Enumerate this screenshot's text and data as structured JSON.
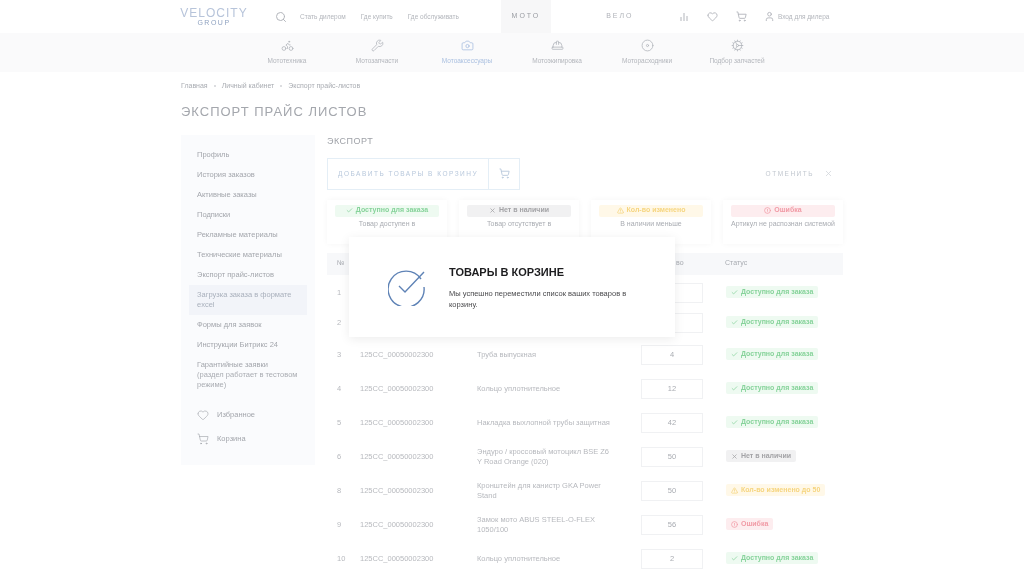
{
  "header": {
    "logo": "VELOCITY",
    "logo_sub": "GROUP",
    "links": [
      "Стать дилером",
      "Где купить",
      "Где обслуживать"
    ],
    "tabs": [
      {
        "label": "МОТО",
        "selected": true
      },
      {
        "label": "ВЕЛО",
        "selected": false
      }
    ],
    "login": "Вход для дилера"
  },
  "categories": [
    {
      "kind": "bike",
      "label": "Мототехника",
      "selected": false
    },
    {
      "kind": "parts",
      "label": "Мотозапчасти",
      "selected": false
    },
    {
      "kind": "accessories",
      "label": "Мотоаксессуары",
      "selected": true
    },
    {
      "kind": "gear",
      "label": "Мотоэкипировка",
      "selected": false
    },
    {
      "kind": "consumables",
      "label": "Моторасходники",
      "selected": false
    },
    {
      "kind": "selection",
      "label": "Подбор запчастей",
      "selected": false
    }
  ],
  "breadcrumbs": [
    "Главная",
    "Личный кабинет",
    "Экспорт прайс-листов"
  ],
  "title": "ЭКСПОРТ ПРАЙС ЛИСТОВ",
  "sidebar": {
    "items": [
      {
        "label": "Профиль",
        "selected": false
      },
      {
        "label": "История заказов",
        "selected": false
      },
      {
        "label": "Активные заказы",
        "selected": false
      },
      {
        "label": "Подписки",
        "selected": false
      },
      {
        "label": "Рекламные материалы",
        "selected": false
      },
      {
        "label": "Технические материалы",
        "selected": false
      },
      {
        "label": "Экспорт прайс-листов",
        "selected": false
      },
      {
        "label": "Загрузка заказа в формате excel",
        "selected": true
      },
      {
        "label": "Формы для заявок",
        "selected": false
      },
      {
        "label": "Инструкции Битрикс 24",
        "selected": false
      },
      {
        "label": "Гарантийные заявки",
        "note": "(раздел работает в тестовом режиме)",
        "selected": false
      }
    ],
    "extras": [
      {
        "kind": "favorites",
        "label": "Избранное"
      },
      {
        "kind": "cart",
        "label": "Корзина"
      }
    ]
  },
  "section_title": "ЭКСПОРТ",
  "add_button": "ДОБАВИТЬ ТОВАРЫ В КОРЗИНУ",
  "cancel_button": "ОТМЕНИТЬ",
  "legend": [
    {
      "kind": "available",
      "label": "Доступно для заказа",
      "description": "Товар доступен в"
    },
    {
      "kind": "out",
      "label": "Нет в наличии",
      "description": "Товар отсутствует в"
    },
    {
      "kind": "changed",
      "label": "Кол-во изменено",
      "description": "В наличии меньше"
    },
    {
      "kind": "error",
      "label": "Ошибка",
      "description": "Артикул не распознан системой"
    }
  ],
  "table": {
    "columns": {
      "number": "№",
      "quantity": "во",
      "status": "Статус"
    },
    "rows": [
      {
        "number": "1",
        "status": {
          "kind": "available",
          "label": "Доступно для заказа"
        }
      },
      {
        "number": "2",
        "status": {
          "kind": "available",
          "label": "Доступно для заказа"
        }
      },
      {
        "number": "3",
        "article": "125CC_00050002300",
        "name": "Труба выпускная",
        "quantity": "4",
        "status": {
          "kind": "available",
          "label": "Доступно для заказа"
        }
      },
      {
        "number": "4",
        "article": "125CC_00050002300",
        "name": "Кольцо уплотнительное",
        "quantity": "12",
        "status": {
          "kind": "available",
          "label": "Доступно для заказа"
        }
      },
      {
        "number": "5",
        "article": "125CC_00050002300",
        "name": "Накладка выхлопной трубы защитная",
        "quantity": "42",
        "status": {
          "kind": "available",
          "label": "Доступно для заказа"
        }
      },
      {
        "number": "6",
        "article": "125CC_00050002300",
        "name": "Эндуро / кроссовый мотоцикл BSE Z6 Y Road Orange (020)",
        "quantity": "50",
        "status": {
          "kind": "out",
          "label": "Нет в наличии"
        }
      },
      {
        "number": "8",
        "article": "125CC_00050002300",
        "name": "Кронштейн для канистр GKA Power Stand",
        "quantity": "50",
        "status": {
          "kind": "changed",
          "label": "Кол-во изменено до 50"
        }
      },
      {
        "number": "9",
        "article": "125CC_00050002300",
        "name": "Замок мото ABUS STEEL-O-FLEX 1050/100",
        "quantity": "56",
        "status": {
          "kind": "error",
          "label": "Ошибка"
        }
      },
      {
        "number": "10",
        "article": "125CC_00050002300",
        "name": "Кольцо уплотнительное",
        "quantity": "2",
        "status": {
          "kind": "available",
          "label": "Доступно для заказа"
        }
      }
    ]
  },
  "modal": {
    "title": "ТОВАРЫ В КОРЗИНЕ",
    "message": "Мы успешно переместили список ваших товаров в корзину."
  }
}
